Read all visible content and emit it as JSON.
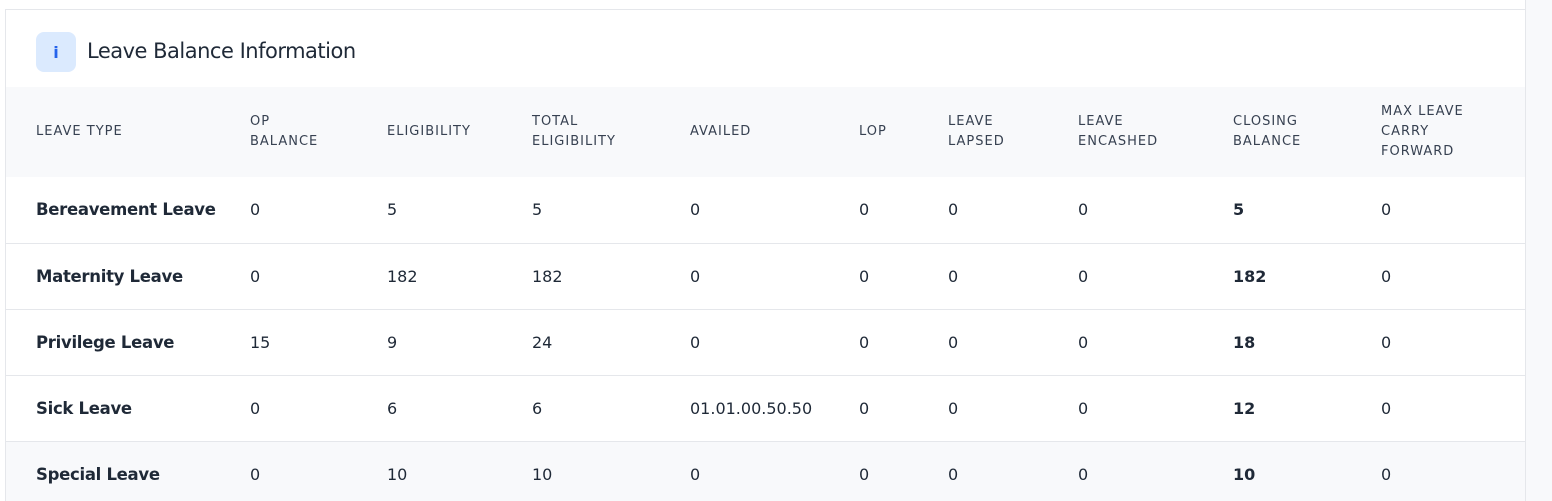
{
  "header": {
    "icon": "info-icon",
    "icon_glyph": "i",
    "title": "Leave Balance Information"
  },
  "table": {
    "columns": [
      {
        "key": "leave_type",
        "label": "LEAVE TYPE",
        "lines": [
          "LEAVE TYPE"
        ]
      },
      {
        "key": "op_balance",
        "label": "OP BALANCE",
        "lines": [
          "OP",
          "BALANCE"
        ]
      },
      {
        "key": "eligibility",
        "label": "ELIGIBILITY",
        "lines": [
          "ELIGIBILITY"
        ]
      },
      {
        "key": "total_eligibility",
        "label": "TOTAL ELIGIBILITY",
        "lines": [
          "TOTAL",
          "ELIGIBILITY"
        ]
      },
      {
        "key": "availed",
        "label": "AVAILED",
        "lines": [
          "AVAILED"
        ]
      },
      {
        "key": "lop",
        "label": "LOP",
        "lines": [
          "LOP"
        ]
      },
      {
        "key": "leave_lapsed",
        "label": "LEAVE LAPSED",
        "lines": [
          "LEAVE",
          "LAPSED"
        ]
      },
      {
        "key": "leave_encashed",
        "label": "LEAVE ENCASHED",
        "lines": [
          "LEAVE",
          "ENCASHED"
        ]
      },
      {
        "key": "closing_balance",
        "label": "CLOSING BALANCE",
        "lines": [
          "CLOSING",
          "BALANCE"
        ]
      },
      {
        "key": "max_carry_forward",
        "label": "MAX LEAVE CARRY FORWARD",
        "lines": [
          "MAX LEAVE",
          "CARRY",
          "FORWARD"
        ]
      }
    ],
    "rows": [
      {
        "leave_type": "Bereavement Leave",
        "op_balance": "0",
        "eligibility": "5",
        "total_eligibility": "5",
        "availed": "0",
        "lop": "0",
        "leave_lapsed": "0",
        "leave_encashed": "0",
        "closing_balance": "5",
        "max_carry_forward": "0"
      },
      {
        "leave_type": "Maternity Leave",
        "op_balance": "0",
        "eligibility": "182",
        "total_eligibility": "182",
        "availed": "0",
        "lop": "0",
        "leave_lapsed": "0",
        "leave_encashed": "0",
        "closing_balance": "182",
        "max_carry_forward": "0"
      },
      {
        "leave_type": "Privilege Leave",
        "op_balance": "15",
        "eligibility": "9",
        "total_eligibility": "24",
        "availed": "0",
        "lop": "0",
        "leave_lapsed": "0",
        "leave_encashed": "0",
        "closing_balance": "18",
        "max_carry_forward": "0"
      },
      {
        "leave_type": "Sick Leave",
        "op_balance": "0",
        "eligibility": "6",
        "total_eligibility": "6",
        "availed": "01.01.00.50.50",
        "lop": "0",
        "leave_lapsed": "0",
        "leave_encashed": "0",
        "closing_balance": "12",
        "max_carry_forward": "0"
      },
      {
        "leave_type": "Special Leave",
        "op_balance": "0",
        "eligibility": "10",
        "total_eligibility": "10",
        "availed": "0",
        "lop": "0",
        "leave_lapsed": "0",
        "leave_encashed": "0",
        "closing_balance": "10",
        "max_carry_forward": "0"
      }
    ]
  },
  "colors": {
    "accent": "#2563eb",
    "badge_bg": "#dbeafe",
    "header_row_bg": "#f8f9fb",
    "border": "#e5e7eb",
    "text": "#1f2937"
  }
}
